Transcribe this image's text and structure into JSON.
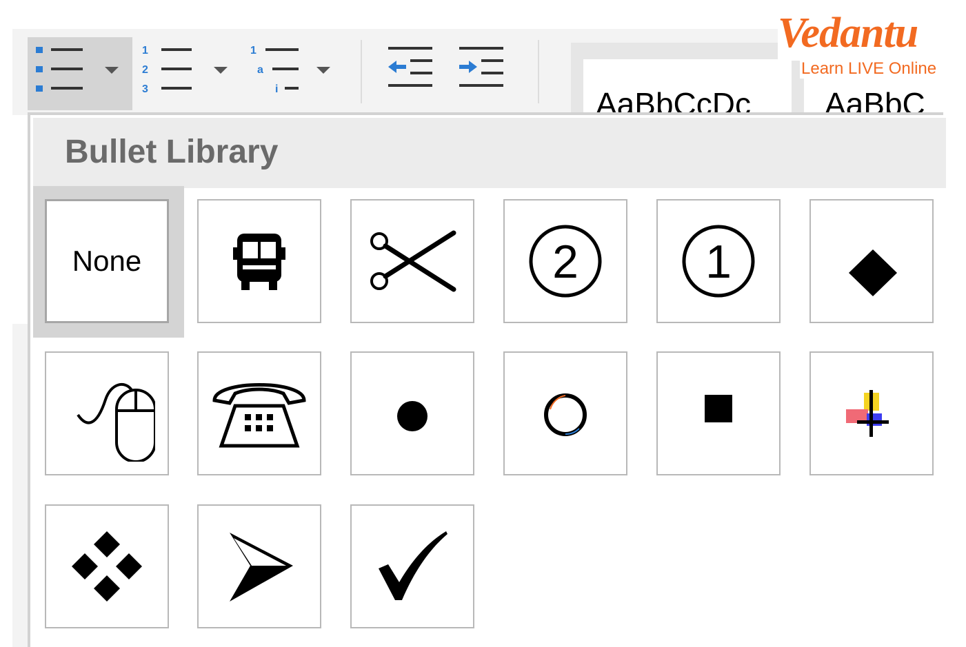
{
  "logo": {
    "name": "Vedantu",
    "tagline": "Learn LIVE Online"
  },
  "ribbon": {
    "bullets_button": "bullets-icon",
    "numbering_button": "numbering-icon",
    "multilevel_button": "multilevel-list-icon",
    "decrease_indent": "decrease-indent-icon",
    "increase_indent": "increase-indent-icon",
    "style_samples": [
      "AaBbCcDc",
      "AaBbC"
    ]
  },
  "bullet_library": {
    "title": "Bullet Library",
    "none_label": "None",
    "selected": "None",
    "items": [
      "none",
      "bus-icon",
      "scissors-icon",
      "circled-two-icon",
      "circled-one-icon",
      "diamond-icon",
      "mouse-icon",
      "telephone-icon",
      "filled-circle-icon",
      "hollow-circle-icon",
      "filled-square-icon",
      "color-cross-icon",
      "four-diamonds-icon",
      "arrowhead-icon",
      "checkmark-icon"
    ]
  },
  "colors": {
    "brand": "#f26a21",
    "indent_arrow": "#2b7cd3"
  }
}
